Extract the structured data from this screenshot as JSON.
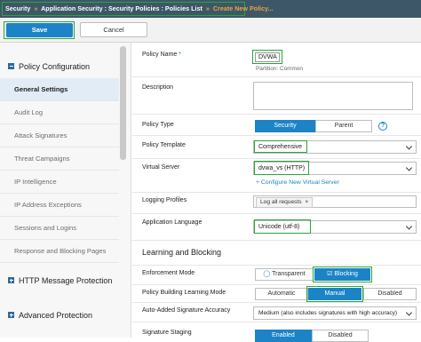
{
  "breadcrumb": {
    "items": [
      "Security",
      "Application Security : Security Policies : Policies List"
    ],
    "separator": "»",
    "current": "Create New Policy..."
  },
  "toolbar": {
    "save_label": "Save",
    "cancel_label": "Cancel"
  },
  "sidebar": {
    "section_policy_configuration": "Policy Configuration",
    "items": [
      {
        "label": "General Settings",
        "active": true
      },
      {
        "label": "Audit Log"
      },
      {
        "label": "Attack Signatures"
      },
      {
        "label": "Threat Campaigns"
      },
      {
        "label": "IP Intelligence"
      },
      {
        "label": "IP Address Exceptions"
      },
      {
        "label": "Sessions and Logins"
      },
      {
        "label": "Response and Blocking Pages"
      }
    ],
    "section_http_message_protection": "HTTP Message Protection",
    "section_advanced_protection": "Advanced Protection"
  },
  "form": {
    "policy_name": {
      "label": "Policy Name",
      "required_marker": "*",
      "value": "DVWA",
      "note": "Partition: Common"
    },
    "description": {
      "label": "Description",
      "value": ""
    },
    "policy_type": {
      "label": "Policy Type",
      "options": [
        "Security",
        "Parent"
      ],
      "selected": "Security",
      "help": "?"
    },
    "policy_template": {
      "label": "Policy Template",
      "value": "Comprehensive"
    },
    "virtual_server": {
      "label": "Virtual Server",
      "value": "dvwa_vs (HTTP)",
      "link": "+ Configure New Virtual Server"
    },
    "logging_profiles": {
      "label": "Logging Profiles",
      "tag": "Log all requests",
      "tag_remove": "×"
    },
    "application_language": {
      "label": "Application Language",
      "value": "Unicode (utf-8)"
    },
    "learning_heading": "Learning and Blocking",
    "enforcement_mode": {
      "label": "Enforcement Mode",
      "options": [
        "Transparent",
        "Blocking"
      ],
      "selected": "Blocking"
    },
    "policy_building_learning_mode": {
      "label": "Policy Building Learning Mode",
      "options": [
        "Automatic",
        "Manual",
        "Disabled"
      ],
      "selected": "Manual"
    },
    "auto_added_signature_accuracy": {
      "label": "Auto-Added Signature Accuracy",
      "value": "Medium (also includes signatures with high accuracy)"
    },
    "signature_staging": {
      "label": "Signature Staging",
      "options": [
        "Enabled",
        "Disabled"
      ],
      "selected": "Enabled"
    }
  },
  "colors": {
    "accent": "#1c84c6",
    "highlight": "#2aa53a",
    "header_bg": "#3d5768",
    "breadcrumb_current": "#e8a33c"
  }
}
